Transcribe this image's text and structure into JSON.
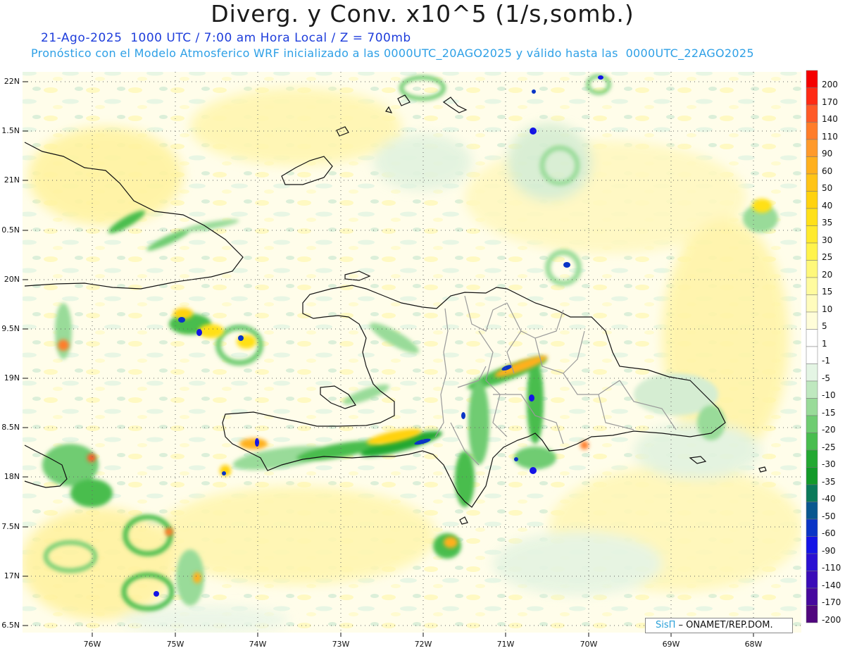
{
  "header": {
    "title": "Diverg. y Conv. x10^5 (1/s,somb.)",
    "date_line": "21-Ago-2025  1000 UTC / 7:00 am Hora Local / Z = 700mb",
    "model_line": "Pronóstico con el Modelo Atmosferico WRF inicializado a las 0000UTC_20AGO2025 y válido hasta las  0000UTC_22AGO2025"
  },
  "map": {
    "lat_labels": [
      "22N",
      "1.5N",
      "21N",
      "0.5N",
      "20N",
      "9.5N",
      "19N",
      "8.5N",
      "18N",
      "7.5N",
      "17N",
      "6.5N"
    ],
    "lon_labels": [
      "76W",
      "75W",
      "74W",
      "73W",
      "72W",
      "71W",
      "70W",
      "69W",
      "68W"
    ]
  },
  "colorbar": {
    "labels": [
      "200",
      "170",
      "140",
      "110",
      "90",
      "60",
      "50",
      "40",
      "35",
      "30",
      "25",
      "20",
      "15",
      "10",
      "5",
      "1",
      "-1",
      "-5",
      "-10",
      "-15",
      "-20",
      "-25",
      "-30",
      "-35",
      "-40",
      "-50",
      "-60",
      "-90",
      "-110",
      "-140",
      "-170",
      "-200"
    ],
    "colors": [
      "#f50000",
      "#ff2a14",
      "#ff5a28",
      "#ff7d2a",
      "#ff9a2c",
      "#ffb01e",
      "#ffc417",
      "#ffd20f",
      "#ffe019",
      "#ffea2e",
      "#fff34c",
      "#fff87a",
      "#fffb9e",
      "#fffcbd",
      "#fffdd9",
      "#ffffff",
      "#ffffff",
      "#e4f5e4",
      "#bfe8bf",
      "#99db99",
      "#6fcc72",
      "#48bd4e",
      "#23a832",
      "#129a29",
      "#0b7a5a",
      "#09578f",
      "#0a35c6",
      "#1414e6",
      "#2a10d2",
      "#3a0cb8",
      "#46089e",
      "#50067e"
    ]
  },
  "credit": {
    "brand": "SisΠ",
    "text": " – ONAMET/REP.DOM."
  }
}
